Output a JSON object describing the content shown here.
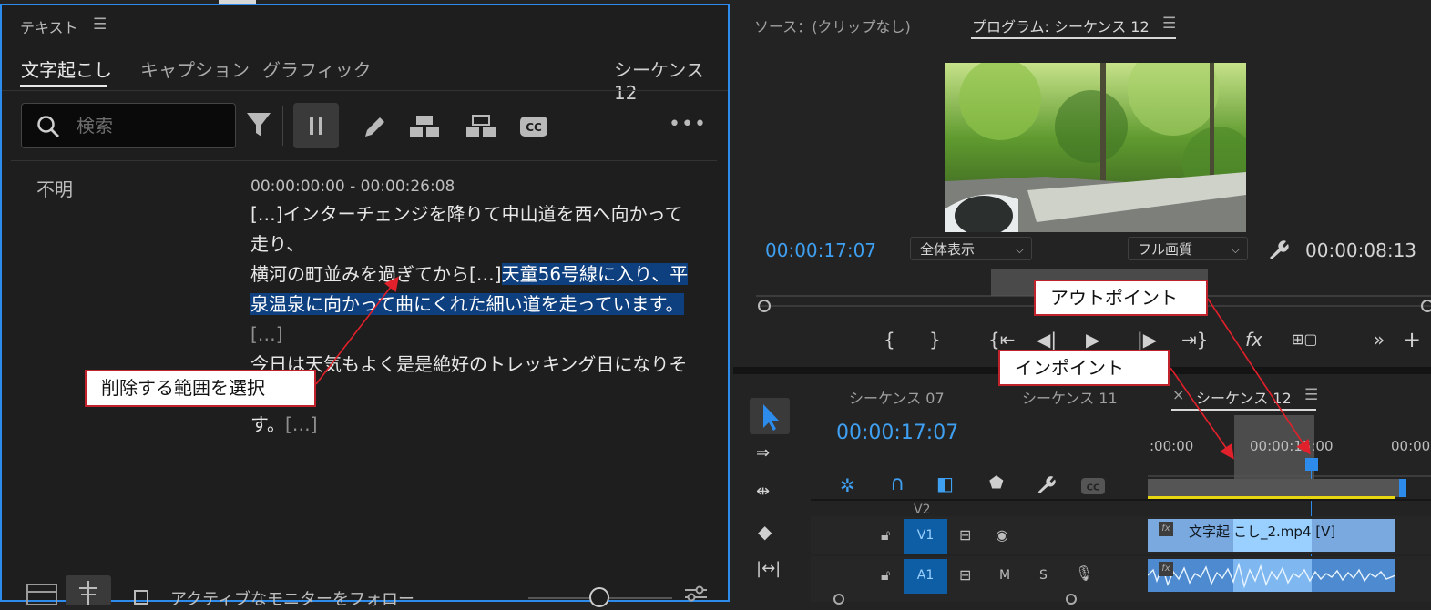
{
  "text_panel": {
    "title": "テキスト",
    "tabs": [
      {
        "label": "文字起こし",
        "active": true
      },
      {
        "label": "キャプション",
        "active": false
      },
      {
        "label": "グラフィック",
        "active": false
      }
    ],
    "sequence_label": "シーケンス 12",
    "search": {
      "placeholder": "検索",
      "value": ""
    },
    "transcript": {
      "speaker": "不明",
      "time_range": "00:00:00:00 - 00:00:26:08",
      "line1": "[…]インターチェンジを降りて中山道を西へ向かって走り、",
      "line2_normal": "横河の町並みを過ぎてから[…]",
      "line2_selected": "天童56号線に入り、平",
      "line3_selected": "泉温泉に向かって曲にくれた細い道を走っています。",
      "line3_gap": "[…]",
      "line4": "今日は天気もよく是是絶好のトレッキング日になりそうで",
      "line5_text": "す。",
      "line5_gap": "[…]"
    },
    "follow_monitor_label": "アクティブなモニターをフォロー"
  },
  "program_monitor": {
    "source_tab": "ソース：(クリップなし)",
    "program_tab": "プログラム: シーケンス 12",
    "current_time": "00:00:17:07",
    "fit_option": "全体表示",
    "quality_option": "フル画質",
    "duration": "00:00:08:13"
  },
  "timeline": {
    "tabs": [
      "シーケンス 07",
      "シーケンス 11",
      "シーケンス 12"
    ],
    "active_tab_close": "×",
    "current_time": "00:00:17:07",
    "ruler_labels": [
      ":00:00",
      "00:00:15:00",
      "00:00:"
    ],
    "tracks": {
      "v2": "V2",
      "v1": "V1",
      "a1": "A1",
      "mute": "M",
      "solo": "S"
    },
    "clip_label_left": "文字起",
    "clip_label_right": "こし_2.mp4 [V]"
  },
  "annotations": {
    "select_range": "削除する範囲を選択",
    "in_point": "インポイント",
    "out_point": "アウトポイント"
  },
  "colors": {
    "accent_blue": "#2d8ceb",
    "selection": "#0e3f7e",
    "callout_border": "#c0232b"
  }
}
